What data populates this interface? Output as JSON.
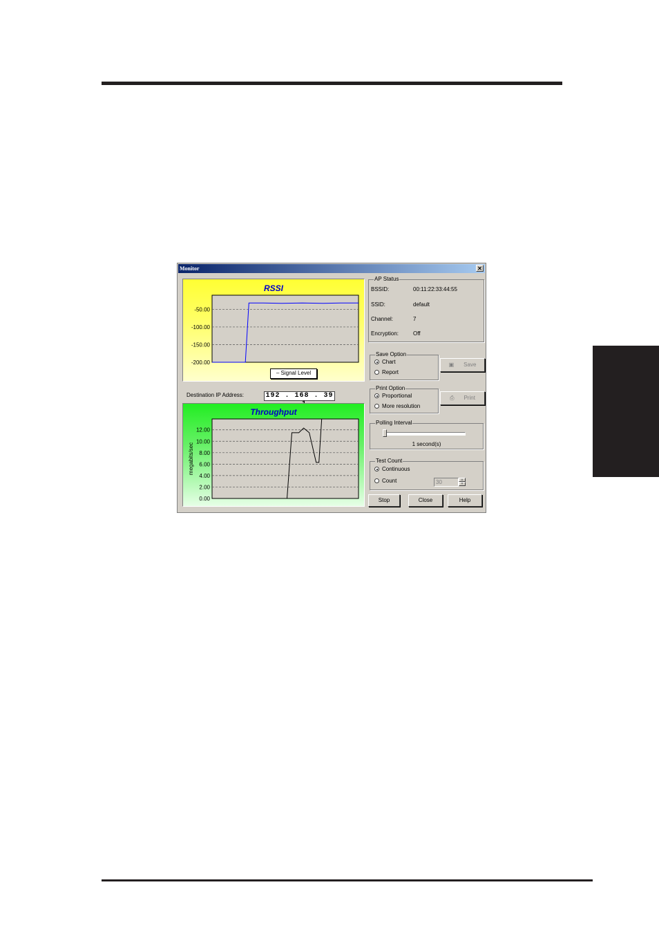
{
  "window": {
    "title": "Monitor",
    "close_label": "✕"
  },
  "rssi": {
    "title": "RSSI",
    "legend": "Signal Level",
    "y_tick_labels": [
      "-50.00",
      "-100.00",
      "-150.00",
      "-200.00"
    ]
  },
  "destination": {
    "label": "Destination IP Address:",
    "ip": "192 . 168 . 39 . 1"
  },
  "throughput": {
    "title": "Throughput",
    "ylabel": "megabits/sec",
    "y_tick_labels": [
      "12.00",
      "10.00",
      "8.00",
      "6.00",
      "4.00",
      "2.00",
      "0.00"
    ]
  },
  "ap_status": {
    "title": "AP Status",
    "rows": [
      {
        "label": "BSSID:",
        "value": "00:11:22:33:44:55"
      },
      {
        "label": "SSID:",
        "value": "default"
      },
      {
        "label": "Channel:",
        "value": "7"
      },
      {
        "label": "Encryption:",
        "value": "Off"
      }
    ]
  },
  "save_option": {
    "title": "Save Option",
    "options": [
      "Chart",
      "Report"
    ],
    "selected": "Chart",
    "button": "Save",
    "button_icon": "floppy-disk-icon"
  },
  "print_option": {
    "title": "Print Option",
    "options": [
      "Proportional",
      "More resolution"
    ],
    "selected": "Proportional",
    "button": "Print",
    "button_icon": "printer-icon"
  },
  "polling": {
    "title": "Polling Interval",
    "value_text": "1 second(s)",
    "slider_fraction": 0.0
  },
  "test_count": {
    "title": "Test Count",
    "options": [
      "Continuous",
      "Count"
    ],
    "selected": "Continuous",
    "count_value": "30"
  },
  "buttons": {
    "stop": "Stop",
    "close": "Close",
    "help": "Help"
  },
  "colors": {
    "rssi_line": "#0000ff",
    "throughput_line": "#000000",
    "rssi_bg": "#ffff33",
    "throughput_bg": "#22ee22",
    "title_text": "#0000c8"
  },
  "chart_data": [
    {
      "type": "line",
      "title": "RSSI",
      "series": [
        {
          "name": "Signal Level",
          "x": [
            0,
            48,
            53,
            70,
            100,
            130,
            160,
            185,
            211
          ],
          "y": [
            -200,
            -200,
            -32,
            -32,
            -33,
            -32,
            -33,
            -32,
            -32
          ]
        }
      ],
      "ylim": [
        -200,
        -10
      ],
      "yticks": [
        -50,
        -100,
        -150,
        -200
      ],
      "grid": true,
      "legend": "bottom-center"
    },
    {
      "type": "line",
      "title": "Throughput",
      "ylabel": "megabits/sec",
      "series": [
        {
          "x": [
            0,
            108,
            115,
            125,
            132,
            140,
            150,
            154,
            158,
            161,
            211
          ],
          "y": [
            0,
            0,
            11.5,
            11.5,
            12.3,
            11.5,
            6.3,
            6.3,
            13.9,
            13.9,
            13.9
          ]
        }
      ],
      "ylim": [
        0,
        13.9
      ],
      "yticks": [
        12,
        10,
        8,
        6,
        4,
        2,
        0
      ],
      "grid": true
    }
  ]
}
